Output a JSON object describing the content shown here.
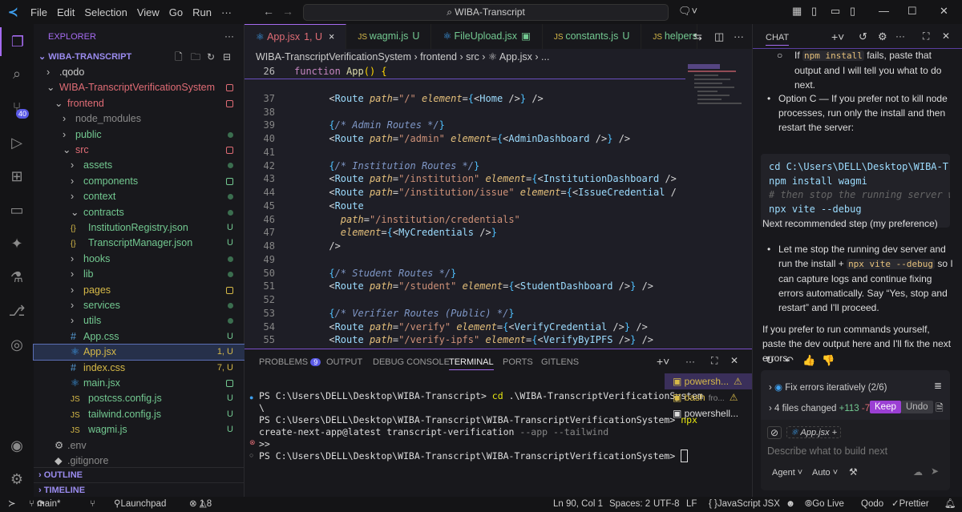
{
  "titlebar": {
    "menu": [
      "File",
      "Edit",
      "Selection",
      "View",
      "Go",
      "Run",
      "···"
    ],
    "search": "WIBA-Transcript"
  },
  "activity": {
    "scm_badge": "40"
  },
  "explorer": {
    "title": "EXPLORER",
    "more": "···",
    "root": "WIBA-TRANSCRIPT",
    "items": [
      {
        "label": ".qodo",
        "depth": 1,
        "chev": ">",
        "color": "",
        "status": ""
      },
      {
        "label": "WIBA-TranscriptVerificationSystem",
        "depth": 1,
        "chev": "v",
        "color": "r",
        "status": "sq-r"
      },
      {
        "label": "frontend",
        "depth": 2,
        "chev": "v",
        "color": "r",
        "status": "sq-r"
      },
      {
        "label": "node_modules",
        "depth": 3,
        "chev": ">",
        "color": "gr",
        "status": ""
      },
      {
        "label": "public",
        "depth": 3,
        "chev": ">",
        "color": "g",
        "status": "dot"
      },
      {
        "label": "src",
        "depth": 3,
        "chev": "v",
        "color": "r",
        "status": "sq-r"
      },
      {
        "label": "assets",
        "depth": 4,
        "chev": ">",
        "color": "g",
        "status": "dot"
      },
      {
        "label": "components",
        "depth": 4,
        "chev": ">",
        "color": "g",
        "status": "sq-g"
      },
      {
        "label": "context",
        "depth": 4,
        "chev": ">",
        "color": "g",
        "status": "dot"
      },
      {
        "label": "contracts",
        "depth": 4,
        "chev": "v",
        "color": "g",
        "status": "dot"
      },
      {
        "label": "InstitutionRegistry.json",
        "depth": 4,
        "chev": "{}",
        "color": "g",
        "status": "U"
      },
      {
        "label": "TranscriptManager.json",
        "depth": 4,
        "chev": "{}",
        "color": "g",
        "status": "U"
      },
      {
        "label": "hooks",
        "depth": 4,
        "chev": ">",
        "color": "g",
        "status": "dot"
      },
      {
        "label": "lib",
        "depth": 4,
        "chev": ">",
        "color": "g",
        "status": "dot"
      },
      {
        "label": "pages",
        "depth": 4,
        "chev": ">",
        "color": "y",
        "status": "sq-y"
      },
      {
        "label": "services",
        "depth": 4,
        "chev": ">",
        "color": "g",
        "status": "dot"
      },
      {
        "label": "utils",
        "depth": 4,
        "chev": ">",
        "color": "g",
        "status": "dot"
      },
      {
        "label": "App.css",
        "depth": 4,
        "chev": "#",
        "color": "g",
        "status": "U"
      },
      {
        "label": "App.jsx",
        "depth": 4,
        "chev": "⚛",
        "color": "y",
        "status": "1, U",
        "selected": true
      },
      {
        "label": "index.css",
        "depth": 4,
        "chev": "#",
        "color": "y",
        "status": "7, U"
      },
      {
        "label": "main.jsx",
        "depth": 4,
        "chev": "⚛",
        "color": "g",
        "status": "sq-g"
      },
      {
        "label": "postcss.config.js",
        "depth": 4,
        "chev": "JS",
        "color": "g",
        "status": "U"
      },
      {
        "label": "tailwind.config.js",
        "depth": 4,
        "chev": "JS",
        "color": "g",
        "status": "U"
      },
      {
        "label": "wagmi.js",
        "depth": 4,
        "chev": "JS",
        "color": "g",
        "status": "U"
      },
      {
        "label": ".env",
        "depth": 2,
        "chev": "⚙",
        "color": "gr",
        "status": ""
      },
      {
        "label": ".gitignore",
        "depth": 2,
        "chev": "◆",
        "color": "gr",
        "status": ""
      }
    ],
    "outline": "OUTLINE",
    "timeline": "TIMELINE"
  },
  "tabs": [
    {
      "icon": "⚛",
      "label": "App.jsx",
      "status": "1, U",
      "close": "×",
      "color": "#e06c75",
      "active": true
    },
    {
      "icon": "JS",
      "label": "wagmi.js",
      "status": "U",
      "color": "#73c991"
    },
    {
      "icon": "⚛",
      "label": "FileUpload.jsx",
      "status": "▣",
      "color": "#73c991"
    },
    {
      "icon": "JS",
      "label": "constants.js",
      "status": "U",
      "color": "#73c991"
    },
    {
      "icon": "JS",
      "label": "helpers.js",
      "status": "",
      "color": "#73c991"
    }
  ],
  "breadcrumb": [
    "WIBA-TranscriptVerificationSystem",
    "frontend",
    "src",
    "⚛ App.jsx",
    "..."
  ],
  "code": [
    {
      "n": "26",
      "segs": [
        [
          "kw",
          "function "
        ],
        [
          "fn",
          "App"
        ],
        [
          "pb",
          "() {"
        ]
      ]
    },
    {
      "n": "37",
      "segs": [
        [
          "pu",
          "      <"
        ],
        [
          "tg",
          "Route "
        ],
        [
          "at",
          "path"
        ],
        [
          "pu",
          "="
        ],
        [
          "st",
          "\"/\" "
        ],
        [
          "at",
          "element"
        ],
        [
          "pu",
          "="
        ],
        [
          "br",
          "{"
        ],
        [
          "pu",
          "<"
        ],
        [
          "tg",
          "Home"
        ],
        [
          "pu",
          " />"
        ],
        [
          "br",
          "}"
        ],
        [
          "pu",
          " />"
        ]
      ]
    },
    {
      "n": "38",
      "segs": []
    },
    {
      "n": "39",
      "segs": [
        [
          "br",
          "      {"
        ],
        [
          "cm",
          "/* Admin Routes */"
        ],
        [
          "br",
          "}"
        ]
      ]
    },
    {
      "n": "40",
      "segs": [
        [
          "pu",
          "      <"
        ],
        [
          "tg",
          "Route "
        ],
        [
          "at",
          "path"
        ],
        [
          "pu",
          "="
        ],
        [
          "st",
          "\"/admin\" "
        ],
        [
          "at",
          "element"
        ],
        [
          "pu",
          "="
        ],
        [
          "br",
          "{"
        ],
        [
          "pu",
          "<"
        ],
        [
          "tg",
          "AdminDashboard"
        ],
        [
          "pu",
          " />"
        ],
        [
          "br",
          "}"
        ],
        [
          "pu",
          " />"
        ]
      ]
    },
    {
      "n": "41",
      "segs": []
    },
    {
      "n": "42",
      "segs": [
        [
          "br",
          "      {"
        ],
        [
          "cm",
          "/* Institution Routes */"
        ],
        [
          "br",
          "}"
        ]
      ]
    },
    {
      "n": "43",
      "segs": [
        [
          "pu",
          "      <"
        ],
        [
          "tg",
          "Route "
        ],
        [
          "at",
          "path"
        ],
        [
          "pu",
          "="
        ],
        [
          "st",
          "\"/institution\" "
        ],
        [
          "at",
          "element"
        ],
        [
          "pu",
          "="
        ],
        [
          "br",
          "{"
        ],
        [
          "pu",
          "<"
        ],
        [
          "tg",
          "InstitutionDashboard"
        ],
        [
          "pu",
          " />"
        ]
      ]
    },
    {
      "n": "44",
      "segs": [
        [
          "pu",
          "      <"
        ],
        [
          "tg",
          "Route "
        ],
        [
          "at",
          "path"
        ],
        [
          "pu",
          "="
        ],
        [
          "st",
          "\"/institution/issue\" "
        ],
        [
          "at",
          "element"
        ],
        [
          "pu",
          "="
        ],
        [
          "br",
          "{"
        ],
        [
          "pu",
          "<"
        ],
        [
          "tg",
          "IssueCredential"
        ],
        [
          "pu",
          " /"
        ]
      ]
    },
    {
      "n": "45",
      "segs": [
        [
          "pu",
          "      <"
        ],
        [
          "tg",
          "Route"
        ]
      ]
    },
    {
      "n": "46",
      "segs": [
        [
          "at",
          "        path"
        ],
        [
          "pu",
          "="
        ],
        [
          "st",
          "\"/institution/credentials\""
        ]
      ]
    },
    {
      "n": "47",
      "segs": [
        [
          "at",
          "        element"
        ],
        [
          "pu",
          "="
        ],
        [
          "br",
          "{"
        ],
        [
          "pu",
          "<"
        ],
        [
          "tg",
          "MyCredentials"
        ],
        [
          "pu",
          " />"
        ],
        [
          "br",
          "}"
        ]
      ]
    },
    {
      "n": "48",
      "segs": [
        [
          "pu",
          "      />"
        ]
      ]
    },
    {
      "n": "49",
      "segs": []
    },
    {
      "n": "50",
      "segs": [
        [
          "br",
          "      {"
        ],
        [
          "cm",
          "/* Student Routes */"
        ],
        [
          "br",
          "}"
        ]
      ]
    },
    {
      "n": "51",
      "segs": [
        [
          "pu",
          "      <"
        ],
        [
          "tg",
          "Route "
        ],
        [
          "at",
          "path"
        ],
        [
          "pu",
          "="
        ],
        [
          "st",
          "\"/student\" "
        ],
        [
          "at",
          "element"
        ],
        [
          "pu",
          "="
        ],
        [
          "br",
          "{"
        ],
        [
          "pu",
          "<"
        ],
        [
          "tg",
          "StudentDashboard"
        ],
        [
          "pu",
          " />"
        ],
        [
          "br",
          "}"
        ],
        [
          "pu",
          " />"
        ]
      ]
    },
    {
      "n": "52",
      "segs": []
    },
    {
      "n": "53",
      "segs": [
        [
          "br",
          "      {"
        ],
        [
          "cm",
          "/* Verifier Routes (Public) */"
        ],
        [
          "br",
          "}"
        ]
      ]
    },
    {
      "n": "54",
      "segs": [
        [
          "pu",
          "      <"
        ],
        [
          "tg",
          "Route "
        ],
        [
          "at",
          "path"
        ],
        [
          "pu",
          "="
        ],
        [
          "st",
          "\"/verify\" "
        ],
        [
          "at",
          "element"
        ],
        [
          "pu",
          "="
        ],
        [
          "br",
          "{"
        ],
        [
          "pu",
          "<"
        ],
        [
          "tg",
          "VerifyCredential"
        ],
        [
          "pu",
          " />"
        ],
        [
          "br",
          "}"
        ],
        [
          "pu",
          " />"
        ]
      ]
    },
    {
      "n": "55",
      "segs": [
        [
          "pu",
          "      <"
        ],
        [
          "tg",
          "Route "
        ],
        [
          "at",
          "path"
        ],
        [
          "pu",
          "="
        ],
        [
          "st",
          "\"/verify-ipfs\" "
        ],
        [
          "at",
          "element"
        ],
        [
          "pu",
          "="
        ],
        [
          "br",
          "{"
        ],
        [
          "pu",
          "<"
        ],
        [
          "tg",
          "VerifyByIPFS"
        ],
        [
          "pu",
          " />"
        ],
        [
          "br",
          "}"
        ],
        [
          "pu",
          " />"
        ]
      ]
    },
    {
      "n": "56",
      "segs": []
    }
  ],
  "panel": {
    "tabs": [
      "PROBLEMS",
      "OUTPUT",
      "DEBUG CONSOLE",
      "TERMINAL",
      "PORTS",
      "GITLENS"
    ],
    "problems_count": "9",
    "terminal": [
      "PS C:\\Users\\DELL\\Desktop\\WIBA-Transcript> cd .\\WIBA-TranscriptVerificationSystem",
      "\\",
      "PS C:\\Users\\DELL\\Desktop\\WIBA-Transcript\\WIBA-TranscriptVerificationSystem> npx",
      "create-next-app@latest transcript-verification --app --tailwind",
      ">>",
      "PS C:\\Users\\DELL\\Desktop\\WIBA-Transcript\\WIBA-TranscriptVerificationSystem> "
    ],
    "terminals": [
      {
        "label": "powersh...",
        "warn": "⚠"
      },
      {
        "label": "bash",
        "sub": "fro...",
        "warn": "⚠"
      },
      {
        "label": "powershell...",
        "warn": ""
      }
    ]
  },
  "chat": {
    "title": "CHAT",
    "p1a": "If",
    "p1code": "npm install",
    "p1b": "fails, paste that output and I will tell you what to do next.",
    "p2": "Option C — If you prefer not to kill node processes, run only the install and then restart the server:",
    "codeblock": [
      "cd C:\\Users\\DELL\\Desktop\\WIBA-Transcript",
      "npm install wagmi",
      "# then stop the running server with Ctrl+C",
      "npx vite --debug"
    ],
    "p3": "Next recommended step (my preference)",
    "p4a": "Let me stop the running dev server and run the install +",
    "p4code": "npx vite --debug",
    "p4b": "so I can capture logs and continue fixing errors automatically. Say “Yes, stop and restart” and I'll proceed.",
    "p5": "If you prefer to run commands yourself, paste the dev output here and I'll fix the next errors.",
    "task": "Fix errors iteratively (2/6)",
    "changed": "4 files changed",
    "added": "+113",
    "removed": "-7",
    "keep": "Keep",
    "undo": "Undo",
    "attachment": "App.jsx",
    "placeholder": "Describe what to build next",
    "mode": "Agent",
    "model": "Auto"
  },
  "status": {
    "branch": "main*",
    "launchpad": "Launchpad",
    "errors": "1",
    "warnings": "8",
    "position": "Ln 90, Col 1",
    "spaces": "Spaces: 2",
    "encoding": "UTF-8",
    "eol": "LF",
    "language": "JavaScript JSX",
    "golive": "Go Live",
    "qodo": "Qodo",
    "prettier": "Prettier"
  }
}
